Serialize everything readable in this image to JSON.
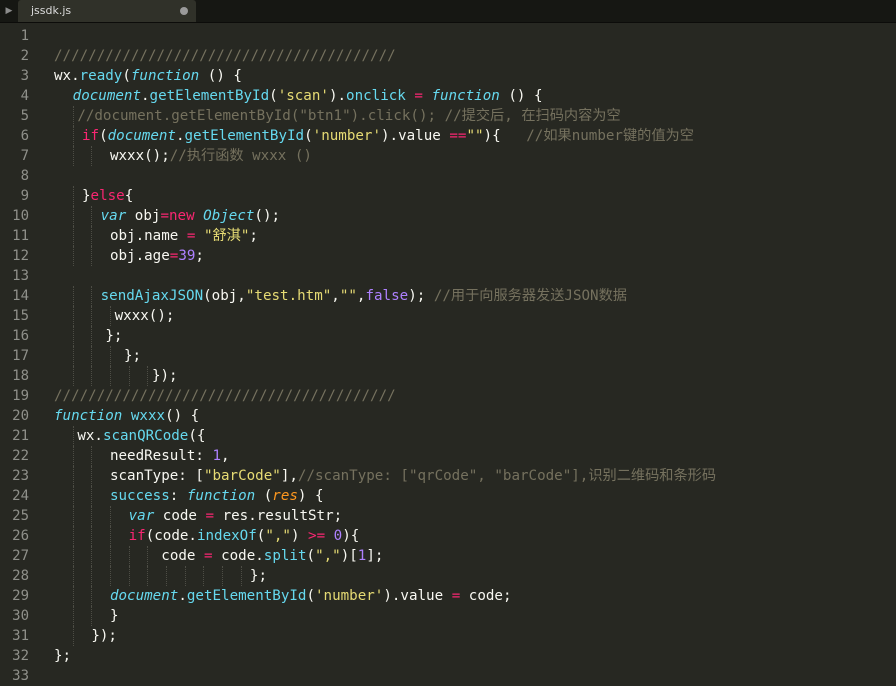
{
  "tab": {
    "title": "jssdk.js",
    "arrow": "▶"
  },
  "lines": [
    {
      "n": "1",
      "i": 0,
      "t": []
    },
    {
      "n": "2",
      "i": 0,
      "t": [
        [
          "co",
          "////////////////////////////////////////"
        ]
      ]
    },
    {
      "n": "3",
      "i": 0,
      "t": [
        [
          "",
          "wx."
        ],
        [
          "fn",
          "ready"
        ],
        [
          "",
          "("
        ],
        [
          "it",
          "function"
        ],
        [
          "",
          " () {"
        ]
      ]
    },
    {
      "n": "4",
      "i": 4,
      "t": [
        [
          "it",
          "document"
        ],
        [
          "",
          "."
        ],
        [
          "fn",
          "getElementById"
        ],
        [
          "",
          "("
        ],
        [
          "st",
          "'scan'"
        ],
        [
          "",
          ")."
        ],
        [
          "fn",
          "onclick"
        ],
        [
          "kw",
          " = "
        ],
        [
          "it",
          "function"
        ],
        [
          "",
          " () {"
        ]
      ]
    },
    {
      "n": "5",
      "i": 5,
      "t": [
        [
          "co",
          "//document.getElementById(\"btn1\").click(); //提交后, 在扫码内容为空"
        ]
      ]
    },
    {
      "n": "6",
      "i": 6,
      "t": [
        [
          "kw",
          "if"
        ],
        [
          "",
          "("
        ],
        [
          "it",
          "document"
        ],
        [
          "",
          "."
        ],
        [
          "fn",
          "getElementById"
        ],
        [
          "",
          "("
        ],
        [
          "st",
          "'number'"
        ],
        [
          "",
          ").value "
        ],
        [
          "kw",
          "=="
        ],
        [
          "st",
          "\"\""
        ],
        [
          "",
          "){   "
        ],
        [
          "co",
          "//如果number键的值为空"
        ]
      ]
    },
    {
      "n": "7",
      "i": 12,
      "t": [
        [
          "",
          "wxxx();"
        ],
        [
          "co",
          "//执行函数 wxxx ()"
        ]
      ]
    },
    {
      "n": "8",
      "i": 0,
      "t": []
    },
    {
      "n": "9",
      "i": 6,
      "t": [
        [
          "",
          "}"
        ],
        [
          "kw",
          "else"
        ],
        [
          "",
          "{"
        ]
      ]
    },
    {
      "n": "10",
      "i": 10,
      "t": [
        [
          "it",
          "var"
        ],
        [
          "",
          " obj"
        ],
        [
          "kw",
          "="
        ],
        [
          "kw",
          "new"
        ],
        [
          "",
          " "
        ],
        [
          "it",
          "Object"
        ],
        [
          "",
          "();"
        ]
      ]
    },
    {
      "n": "11",
      "i": 12,
      "t": [
        [
          "",
          "obj.name "
        ],
        [
          "kw",
          "="
        ],
        [
          "",
          " "
        ],
        [
          "st",
          "\"舒淇\""
        ],
        [
          "",
          ";"
        ]
      ]
    },
    {
      "n": "12",
      "i": 12,
      "t": [
        [
          "",
          "obj.age"
        ],
        [
          "kw",
          "="
        ],
        [
          "nu",
          "39"
        ],
        [
          "",
          ";"
        ]
      ]
    },
    {
      "n": "13",
      "i": 0,
      "t": []
    },
    {
      "n": "14",
      "i": 10,
      "t": [
        [
          "fn",
          "sendAjaxJSON"
        ],
        [
          "",
          "(obj,"
        ],
        [
          "st",
          "\"test.htm\""
        ],
        [
          "",
          ","
        ],
        [
          "st",
          "\"\""
        ],
        [
          "",
          ","
        ],
        [
          "nu",
          "false"
        ],
        [
          "",
          "); "
        ],
        [
          "co",
          "//用于向服务器发送JSON数据"
        ]
      ]
    },
    {
      "n": "15",
      "i": 13,
      "t": [
        [
          "",
          "wxxx();"
        ]
      ]
    },
    {
      "n": "16",
      "i": 11,
      "t": [
        [
          "",
          "};"
        ]
      ]
    },
    {
      "n": "17",
      "i": 15,
      "t": [
        [
          "",
          "};"
        ]
      ]
    },
    {
      "n": "18",
      "i": 21,
      "t": [
        [
          "",
          "});"
        ]
      ]
    },
    {
      "n": "19",
      "i": 0,
      "t": [
        [
          "co",
          "////////////////////////////////////////"
        ]
      ]
    },
    {
      "n": "20",
      "i": 0,
      "t": [
        [
          "it",
          "function"
        ],
        [
          "",
          " "
        ],
        [
          "fn",
          "wxxx"
        ],
        [
          "",
          "() {"
        ]
      ]
    },
    {
      "n": "21",
      "i": 5,
      "t": [
        [
          "",
          "wx."
        ],
        [
          "fn",
          "scanQRCode"
        ],
        [
          "",
          "({"
        ]
      ]
    },
    {
      "n": "22",
      "i": 12,
      "t": [
        [
          "",
          "needResult: "
        ],
        [
          "nu",
          "1"
        ],
        [
          "",
          ","
        ]
      ]
    },
    {
      "n": "23",
      "i": 12,
      "t": [
        [
          "",
          "scanType: ["
        ],
        [
          "st",
          "\"barCode\""
        ],
        [
          "",
          "],"
        ],
        [
          "co",
          "//scanType: [\"qrCode\", \"barCode\"],识别二维码和条形码"
        ]
      ]
    },
    {
      "n": "24",
      "i": 12,
      "t": [
        [
          "fn",
          "success"
        ],
        [
          "",
          ": "
        ],
        [
          "it",
          "function"
        ],
        [
          "",
          " ("
        ],
        [
          "pa",
          "res"
        ],
        [
          "",
          ") {"
        ]
      ]
    },
    {
      "n": "25",
      "i": 16,
      "t": [
        [
          "it",
          "var"
        ],
        [
          "",
          " code "
        ],
        [
          "kw",
          "="
        ],
        [
          "",
          " res.resultStr;"
        ]
      ]
    },
    {
      "n": "26",
      "i": 16,
      "t": [
        [
          "kw",
          "if"
        ],
        [
          "",
          "(code."
        ],
        [
          "fn",
          "indexOf"
        ],
        [
          "",
          "("
        ],
        [
          "st",
          "\",\""
        ],
        [
          "",
          ") "
        ],
        [
          "kw",
          ">="
        ],
        [
          "",
          " "
        ],
        [
          "nu",
          "0"
        ],
        [
          "",
          "){"
        ]
      ]
    },
    {
      "n": "27",
      "i": 23,
      "t": [
        [
          "",
          "code "
        ],
        [
          "kw",
          "="
        ],
        [
          "",
          " code."
        ],
        [
          "fn",
          "split"
        ],
        [
          "",
          "("
        ],
        [
          "st",
          "\",\""
        ],
        [
          "",
          ")["
        ],
        [
          "nu",
          "1"
        ],
        [
          "",
          "];"
        ]
      ]
    },
    {
      "n": "28",
      "i": 42,
      "t": [
        [
          "",
          "};"
        ]
      ]
    },
    {
      "n": "29",
      "i": 12,
      "t": [
        [
          "it",
          "document"
        ],
        [
          "",
          "."
        ],
        [
          "fn",
          "getElementById"
        ],
        [
          "",
          "("
        ],
        [
          "st",
          "'number'"
        ],
        [
          "",
          ").value "
        ],
        [
          "kw",
          "="
        ],
        [
          "",
          " code;"
        ]
      ]
    },
    {
      "n": "30",
      "i": 12,
      "t": [
        [
          "",
          "}"
        ]
      ]
    },
    {
      "n": "31",
      "i": 8,
      "t": [
        [
          "",
          "});"
        ]
      ]
    },
    {
      "n": "32",
      "i": 0,
      "t": [
        [
          "",
          "};"
        ]
      ]
    },
    {
      "n": "33",
      "i": 0,
      "t": []
    }
  ]
}
